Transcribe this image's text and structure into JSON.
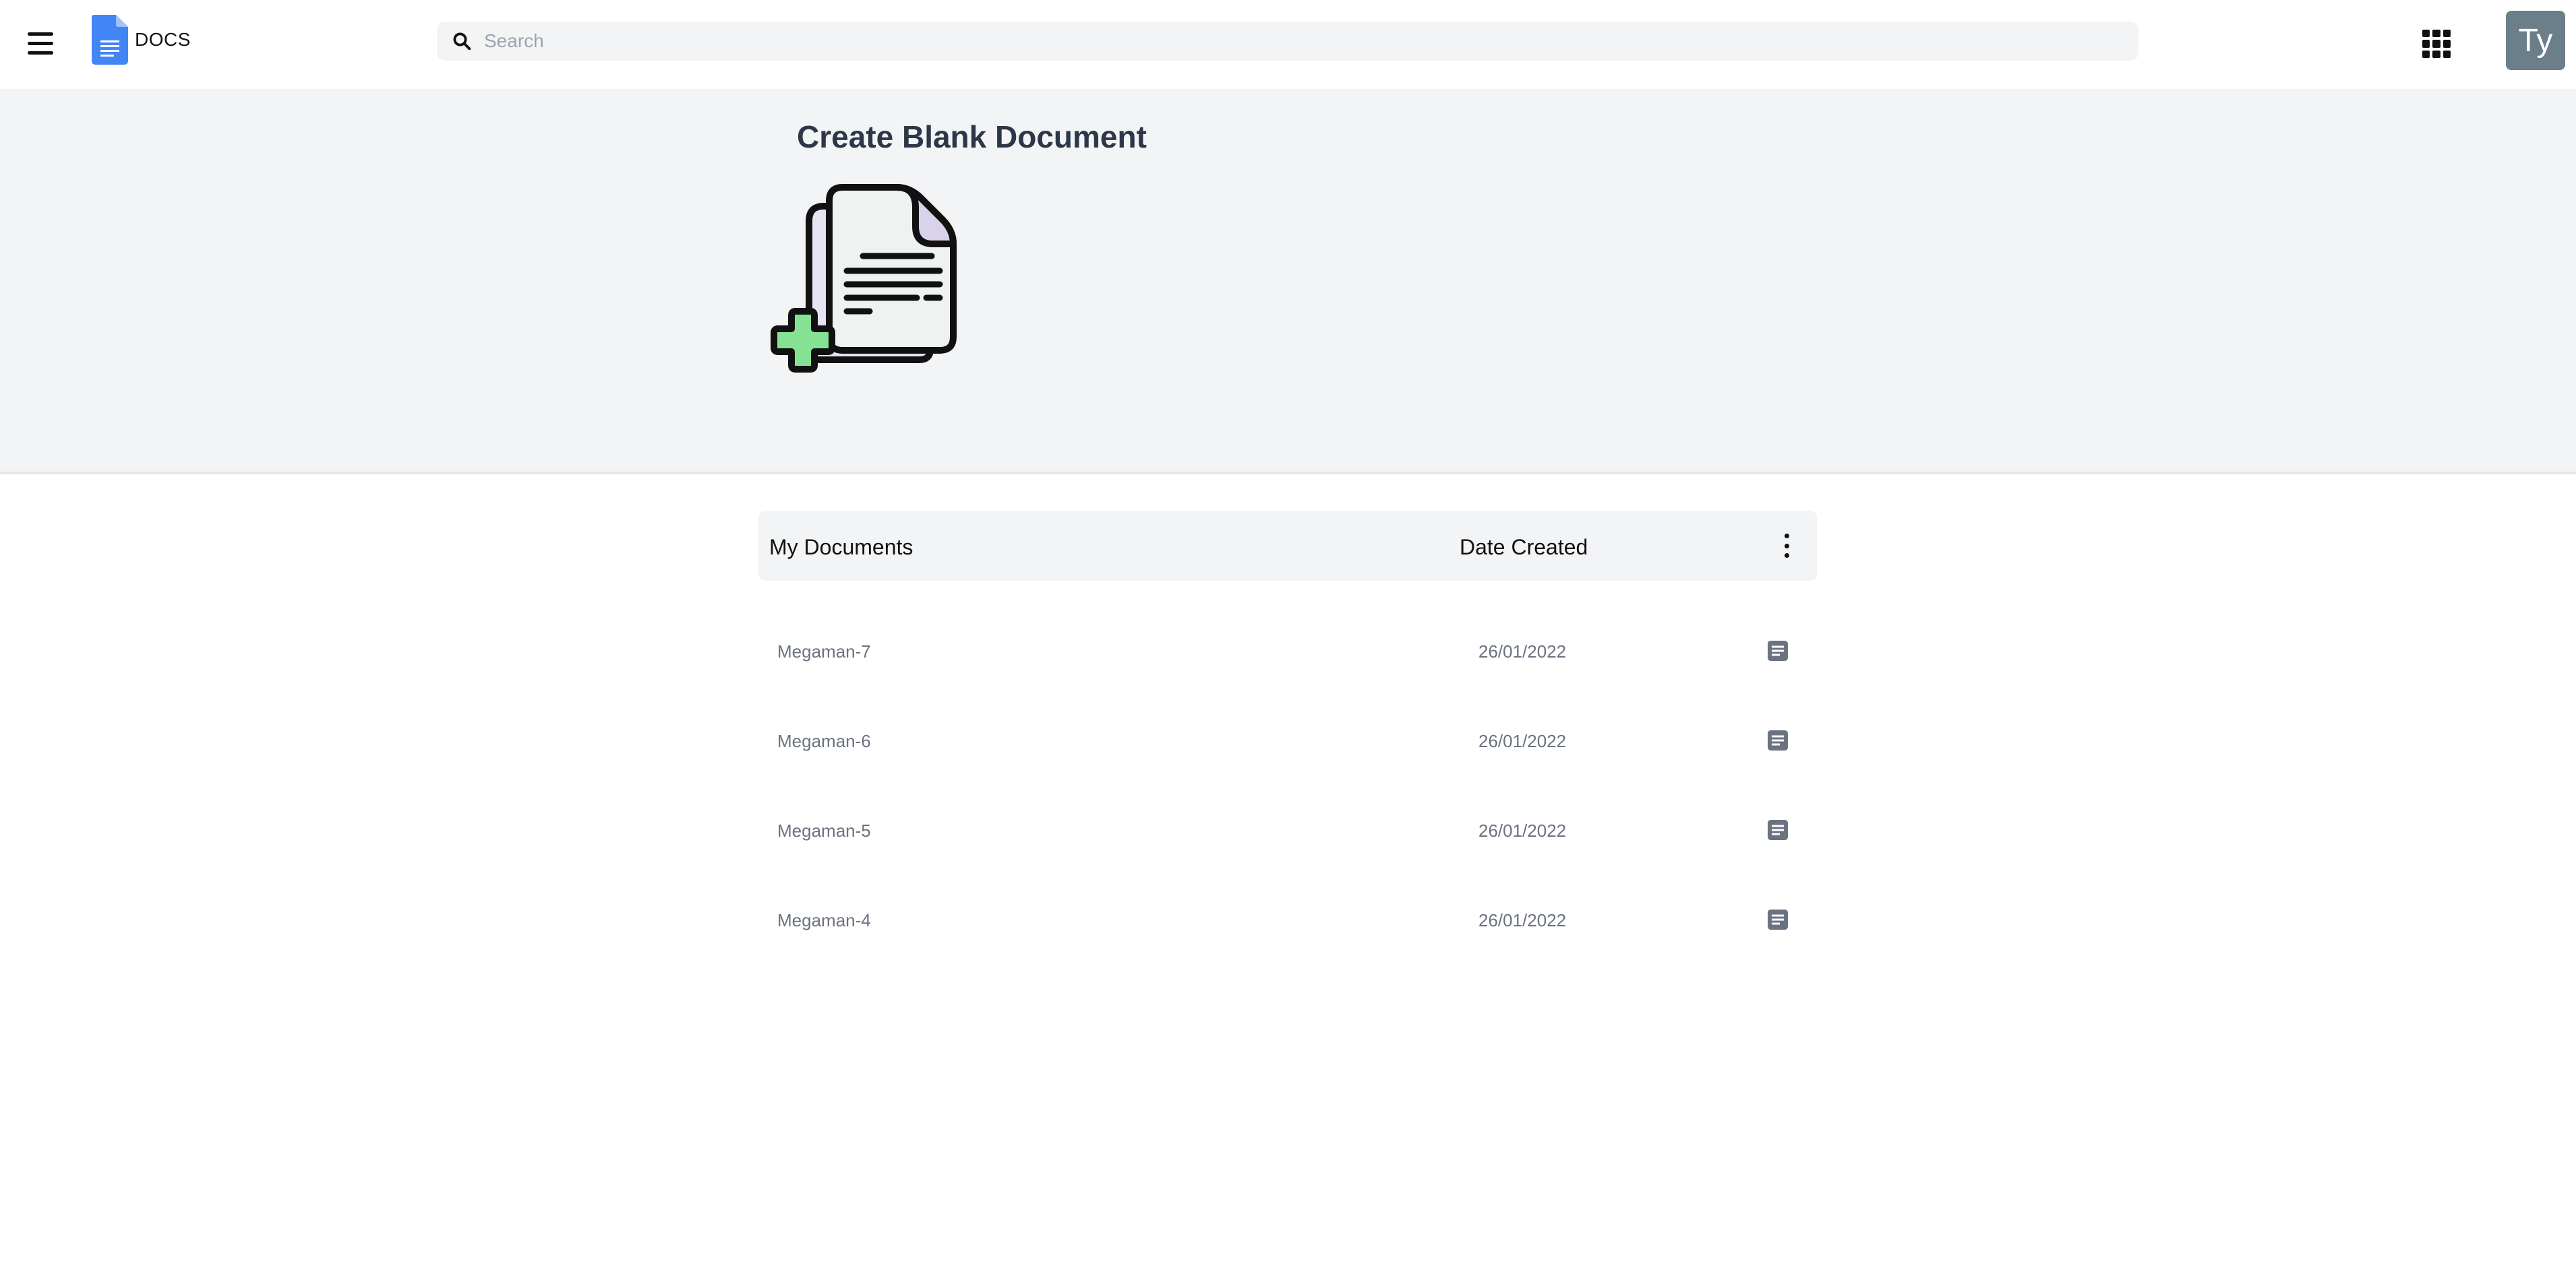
{
  "header": {
    "logo_text": "DOCS",
    "search_placeholder": "Search",
    "avatar_initials": "Ty"
  },
  "create": {
    "title": "Create Blank Document"
  },
  "documents": {
    "header_title": "My Documents",
    "header_date": "Date Created",
    "rows": [
      {
        "name": "Megaman-7",
        "date": "26/01/2022"
      },
      {
        "name": "Megaman-6",
        "date": "26/01/2022"
      },
      {
        "name": "Megaman-5",
        "date": "26/01/2022"
      },
      {
        "name": "Megaman-4",
        "date": "26/01/2022"
      }
    ]
  },
  "colors": {
    "brand": "#4285f4",
    "avatar_bg": "#6b7f8a",
    "section_bg": "#f3f4f6",
    "plus_green": "#86e293"
  }
}
